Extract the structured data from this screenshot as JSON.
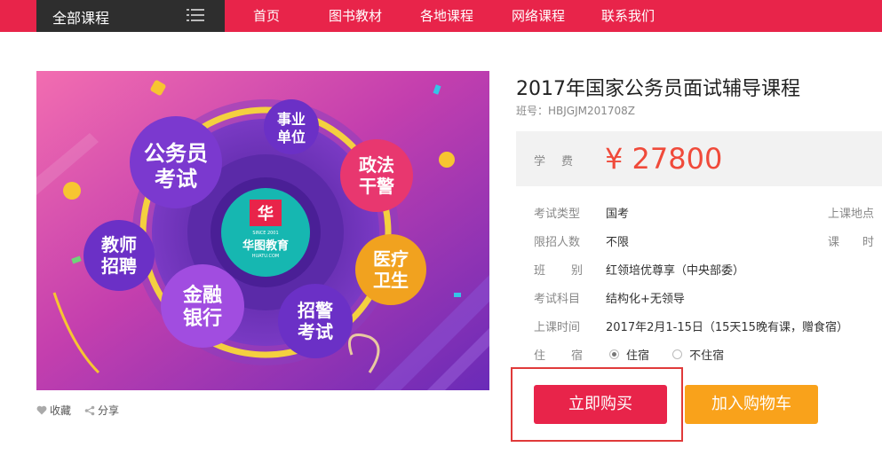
{
  "nav": {
    "all_courses": "全部课程",
    "links": [
      "首页",
      "图书教材",
      "各地课程",
      "网络课程",
      "联系我们"
    ]
  },
  "hero": {
    "categories": [
      "事业单位",
      "公务员考试",
      "政法干警",
      "教师招聘",
      "医疗卫生",
      "金融银行",
      "招警考试"
    ],
    "logo_since": "SINCE 2001",
    "logo_name": "华图教育",
    "logo_url": "HUATU.COM"
  },
  "actions": {
    "favorite": "收藏",
    "share": "分享"
  },
  "product": {
    "title": "2017年国家公务员面试辅导课程",
    "class_code": "班号：HBJGJM201708Z",
    "fee_label": "学费",
    "price": "¥ 27800",
    "attrs": [
      {
        "label": "考试类型",
        "value": "国考"
      },
      {
        "label": "限招人数",
        "value": "不限"
      },
      {
        "label": "班别",
        "value": "红领培优尊享（中央部委）"
      },
      {
        "label": "考试科目",
        "value": "结构化+无领导"
      },
      {
        "label": "上课时间",
        "value": "2017年2月1-15日（15天15晚有课，赠食宿）"
      }
    ],
    "lodging_label": "住宿",
    "lodging_options": [
      "住宿",
      "不住宿"
    ],
    "lodging_selected": "住宿",
    "right_labels": [
      "上课地点",
      "课时"
    ],
    "buy_label": "立即购买",
    "cart_label": "加入购物车"
  },
  "colors": {
    "nav_bg": "#e8244a",
    "all_courses_bg": "#2e2e2e",
    "price": "#f04a3a",
    "buy": "#e8244a",
    "cart": "#f9a21b"
  }
}
